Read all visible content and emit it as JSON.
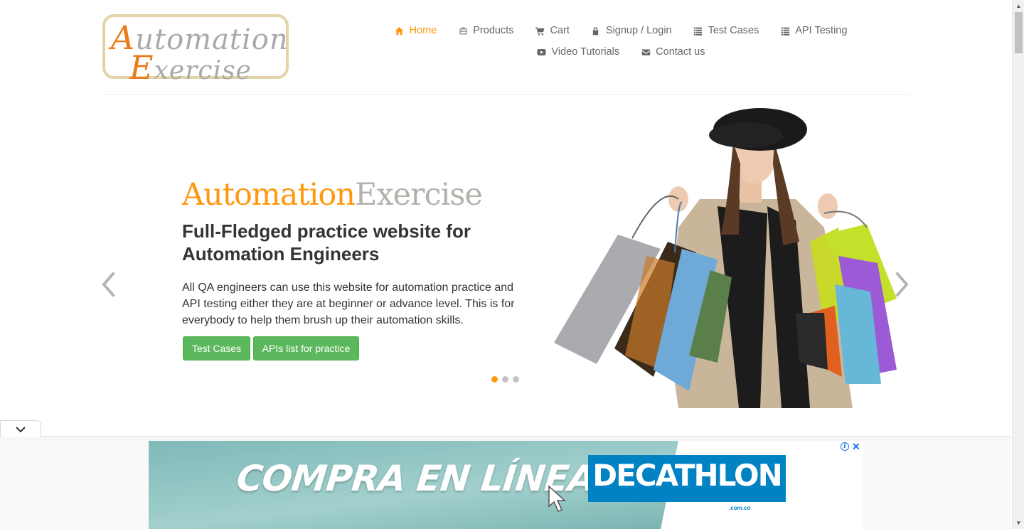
{
  "logo": {
    "line1_cap": "A",
    "line1_rest": "utomation",
    "line2_cap": "E",
    "line2_rest": "xercise"
  },
  "nav": {
    "row1": [
      {
        "label": "Home",
        "icon": "home-icon",
        "active": true
      },
      {
        "label": "Products",
        "icon": "briefcase-icon",
        "active": false
      },
      {
        "label": "Cart",
        "icon": "shopping-cart-icon",
        "active": false
      },
      {
        "label": "Signup / Login",
        "icon": "lock-icon",
        "active": false
      },
      {
        "label": "Test Cases",
        "icon": "list-icon",
        "active": false
      },
      {
        "label": "API Testing",
        "icon": "list-icon",
        "active": false
      }
    ],
    "row2": [
      {
        "label": "Video Tutorials",
        "icon": "youtube-play-icon",
        "active": false
      },
      {
        "label": "Contact us",
        "icon": "envelope-icon",
        "active": false
      }
    ]
  },
  "slider": {
    "brand_part1": "Automation",
    "brand_part2": "Exercise",
    "headline": "Full-Fledged practice website for Automation Engineers",
    "description": "All QA engineers can use this website for automation practice and API testing either they are at beginner or advance level. This is for everybody to help them brush up their automation skills.",
    "test_cases_button": "Test Cases",
    "apis_button": "APIs list for practice",
    "active_slide": 1,
    "slide_count": 3
  },
  "ad": {
    "headline": "COMPRA EN LÍNEA",
    "brand": "DECATHLON",
    "brand_sub": ".com.co"
  },
  "colors": {
    "accent": "#fe980f",
    "button_green": "#5cb85c",
    "text_dark": "#363432",
    "text_nav": "#696763",
    "decathlon_blue": "#0082c3"
  }
}
